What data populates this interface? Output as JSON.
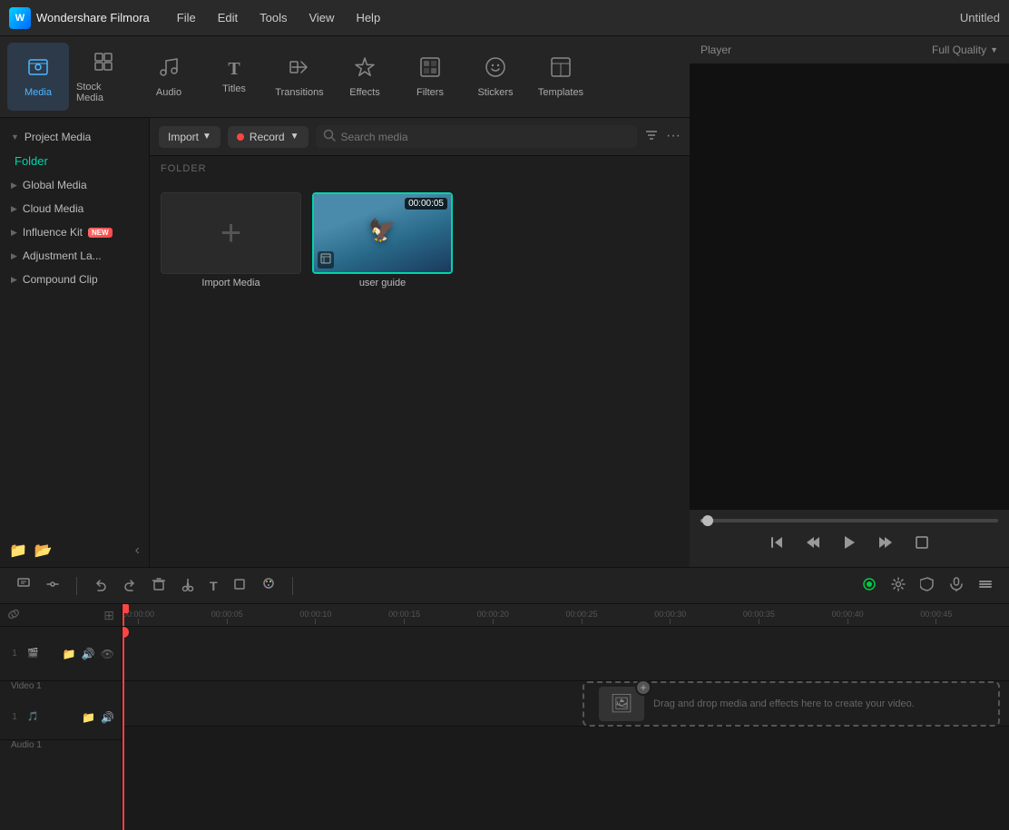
{
  "app": {
    "name": "Wondershare Filmora",
    "title": "Untitled"
  },
  "menu": {
    "items": [
      "File",
      "Edit",
      "Tools",
      "View",
      "Help"
    ]
  },
  "toolbar": {
    "items": [
      {
        "id": "media",
        "label": "Media",
        "icon": "🎬",
        "active": true
      },
      {
        "id": "stock",
        "label": "Stock Media",
        "icon": "📦",
        "active": false
      },
      {
        "id": "audio",
        "label": "Audio",
        "icon": "🎵",
        "active": false
      },
      {
        "id": "titles",
        "label": "Titles",
        "icon": "T",
        "active": false
      },
      {
        "id": "transitions",
        "label": "Transitions",
        "icon": "⇄",
        "active": false
      },
      {
        "id": "effects",
        "label": "Effects",
        "icon": "✨",
        "active": false
      },
      {
        "id": "filters",
        "label": "Filters",
        "icon": "🔲",
        "active": false
      },
      {
        "id": "stickers",
        "label": "Stickers",
        "icon": "🎭",
        "active": false
      },
      {
        "id": "templates",
        "label": "Templates",
        "icon": "⬛",
        "active": false
      }
    ]
  },
  "sidebar": {
    "items": [
      {
        "id": "project-media",
        "label": "Project Media",
        "arrow": "▶",
        "active": false,
        "expanded": true
      },
      {
        "id": "folder",
        "label": "Folder",
        "active": true
      },
      {
        "id": "global-media",
        "label": "Global Media",
        "arrow": "▶"
      },
      {
        "id": "cloud-media",
        "label": "Cloud Media",
        "arrow": "▶"
      },
      {
        "id": "influence-kit",
        "label": "Influence Kit",
        "arrow": "▶",
        "badge": "NEW"
      },
      {
        "id": "adjustment-la",
        "label": "Adjustment La...",
        "arrow": "▶"
      },
      {
        "id": "compound-clip",
        "label": "Compound Clip",
        "arrow": "▶"
      }
    ],
    "bottom": {
      "new_folder": "📁",
      "folder": "📂",
      "collapse": "‹"
    }
  },
  "media_toolbar": {
    "import_label": "Import",
    "record_label": "Record",
    "search_placeholder": "Search media"
  },
  "folder_section": {
    "label": "FOLDER"
  },
  "media_items": [
    {
      "id": "import",
      "type": "import",
      "label": "Import Media",
      "is_import": true
    },
    {
      "id": "user-guide",
      "type": "video",
      "label": "user guide",
      "duration": "00:00:05",
      "selected": true
    }
  ],
  "player": {
    "label": "Player",
    "quality": "Full Quality",
    "progress": 3
  },
  "player_controls": {
    "prev": "⏮",
    "rewind": "◀",
    "play": "▶",
    "forward": "▶▶",
    "fullscreen": "⬜"
  },
  "timeline": {
    "tools": [
      {
        "id": "select",
        "icon": "↗",
        "label": "Select"
      },
      {
        "id": "ripple",
        "icon": "⚡",
        "label": "Ripple"
      },
      {
        "id": "undo",
        "icon": "↩",
        "label": "Undo"
      },
      {
        "id": "redo",
        "icon": "↪",
        "label": "Redo"
      },
      {
        "id": "delete",
        "icon": "🗑",
        "label": "Delete"
      },
      {
        "id": "cut",
        "icon": "✂",
        "label": "Cut"
      },
      {
        "id": "text",
        "icon": "T",
        "label": "Text"
      },
      {
        "id": "crop",
        "icon": "⬚",
        "label": "Crop"
      },
      {
        "id": "color",
        "icon": "🎨",
        "label": "Color"
      }
    ],
    "right_tools": [
      {
        "id": "record",
        "icon": "⏺",
        "label": "Record",
        "active": true,
        "color": "#00cc44"
      },
      {
        "id": "settings",
        "icon": "⚙",
        "label": "Settings"
      },
      {
        "id": "shield",
        "icon": "🛡",
        "label": "Shield"
      },
      {
        "id": "mic",
        "icon": "🎤",
        "label": "Mic"
      },
      {
        "id": "more",
        "icon": "≡",
        "label": "More"
      }
    ],
    "ruler_marks": [
      "00:00:00",
      "00:00:05",
      "00:00:10",
      "00:00:15",
      "00:00:20",
      "00:00:25",
      "00:00:30",
      "00:00:35",
      "00:00:40",
      "00:00:45"
    ],
    "tracks": [
      {
        "id": "video1",
        "type": "video",
        "name": "Video 1",
        "num": "1",
        "icons": [
          "🔗",
          "📁",
          "🔊",
          "👁"
        ]
      },
      {
        "id": "audio1",
        "type": "audio",
        "name": "Audio 1",
        "num": "1",
        "icons": [
          "📁",
          "🔊"
        ]
      }
    ],
    "drop_zone_text": "Drag and drop media and effects here to create your video.",
    "link_icon": "🔗",
    "add_track_icon": "⊞"
  }
}
